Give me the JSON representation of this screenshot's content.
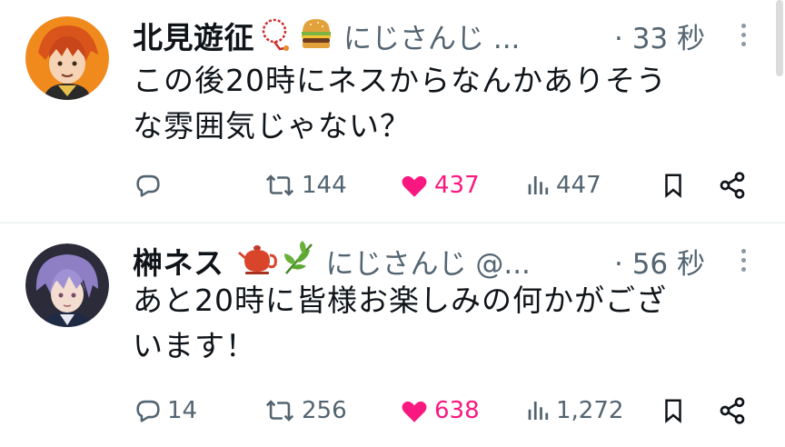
{
  "tweets": [
    {
      "author_name": "北見遊征",
      "handle": "にじさんじ ...",
      "time": "· 33 秒",
      "text_line1": "この後20時にネスからなんかありそう",
      "text_line2": "な雰囲気じゃない？",
      "reply_count": "",
      "retweet_count": "144",
      "like_count": "437",
      "view_count": "447",
      "emojis": [
        "prayer-beads",
        "hamburger"
      ]
    },
    {
      "author_name": "榊ネス",
      "handle": "にじさんじ @...",
      "time": "· 56 秒",
      "text_line1": "あと20時に皆様お楽しみの何かがござ",
      "text_line2": "います！",
      "reply_count": "14",
      "retweet_count": "256",
      "like_count": "638",
      "view_count": "1,272",
      "emojis": [
        "teapot",
        "herb"
      ]
    }
  ],
  "colors": {
    "text": "#0f1419",
    "secondary": "#536471",
    "like": "#f91880",
    "divider": "#eff3f4"
  }
}
